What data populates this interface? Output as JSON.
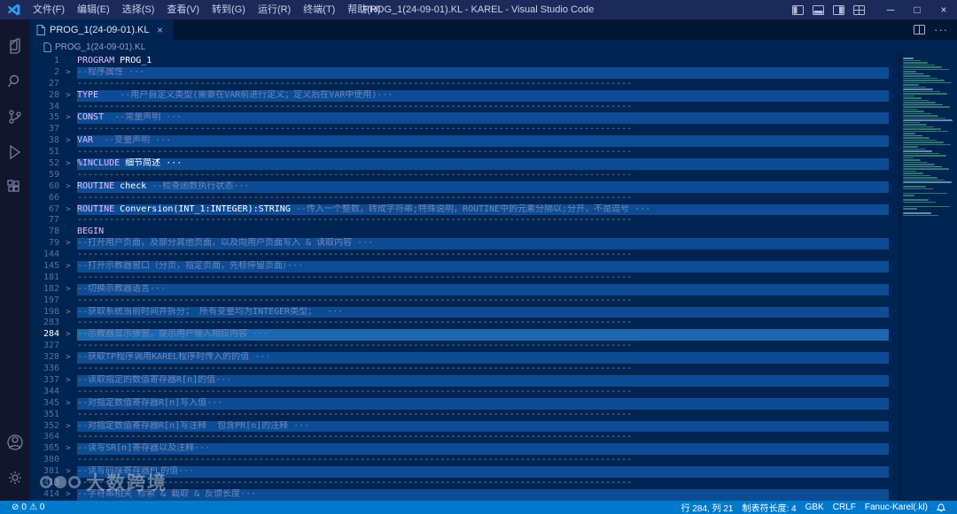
{
  "window": {
    "title": "PROG_1(24-09-01).KL - KAREL - Visual Studio Code",
    "menus": [
      "文件(F)",
      "编辑(E)",
      "选择(S)",
      "查看(V)",
      "转到(G)",
      "运行(R)",
      "终端(T)",
      "帮助(H)"
    ],
    "controls": {
      "minimize": "─",
      "maximize": "□",
      "close": "×"
    }
  },
  "tabs": [
    {
      "label": "PROG_1(24-09-01).KL",
      "close": "×",
      "active": true
    }
  ],
  "tabbar_actions": {
    "more": "···"
  },
  "breadcrumb": {
    "file": "PROG_1(24-09-01).KL"
  },
  "activity_bar": {
    "items": [
      "explorer",
      "search",
      "source-control",
      "run-debug",
      "extensions"
    ],
    "bottom": [
      "account",
      "settings"
    ]
  },
  "editor": {
    "dash_text": "--------------------------------------------------------------------------------------------------------",
    "fold_chevron": ">",
    "lines": [
      {
        "n": 1,
        "s": [
          {
            "t": "PROGRAM ",
            "c": "kw"
          },
          {
            "t": "PROG_1",
            "c": "id"
          }
        ]
      },
      {
        "n": 2,
        "f": true,
        "s": [
          {
            "t": "--程序属性 ···",
            "c": "cm"
          }
        ]
      },
      {
        "n": 27,
        "d": true
      },
      {
        "n": 28,
        "f": true,
        "s": [
          {
            "t": "TYPE",
            "c": "kw"
          },
          {
            "t": "    --用户自定义类型(需要在VAR前进行定义；定义后在VAR中使用)···",
            "c": "cm"
          }
        ]
      },
      {
        "n": 34,
        "d": true
      },
      {
        "n": 35,
        "f": true,
        "s": [
          {
            "t": "CONST",
            "c": "kw"
          },
          {
            "t": "  --常量声明 ···",
            "c": "cm"
          }
        ]
      },
      {
        "n": 37,
        "d": true
      },
      {
        "n": 38,
        "f": true,
        "s": [
          {
            "t": "VAR",
            "c": "kw"
          },
          {
            "t": "  --变量声明 ···",
            "c": "cm"
          }
        ]
      },
      {
        "n": 51,
        "d": true
      },
      {
        "n": 52,
        "f": true,
        "s": [
          {
            "t": "%INCLUDE ",
            "c": "kw"
          },
          {
            "t": "细节简述 ···",
            "c": "id"
          }
        ]
      },
      {
        "n": 59,
        "d": true
      },
      {
        "n": 60,
        "f": true,
        "s": [
          {
            "t": "ROUTINE",
            "c": "kw"
          },
          {
            "t": " check ",
            "c": "id"
          },
          {
            "t": "--检查函数执行状态···",
            "c": "cm"
          }
        ]
      },
      {
        "n": 66,
        "d": true
      },
      {
        "n": 67,
        "f": true,
        "s": [
          {
            "t": "ROUTINE",
            "c": "kw"
          },
          {
            "t": " Conversion(INT_1:INTEGER):STRING ",
            "c": "id"
          },
          {
            "t": "--传入一个整数，转成字符串;特殊说明，ROUTINE中的元素分隔以;分开，不是逗号 ···",
            "c": "cm"
          }
        ]
      },
      {
        "n": 77,
        "d": true
      },
      {
        "n": 78,
        "s": [
          {
            "t": "BEGIN",
            "c": "kw"
          }
        ]
      },
      {
        "n": 79,
        "f": true,
        "s": [
          {
            "t": "--打开用户页面，及部分其他页面，以及向用户页面写入 & 读取内容 ···",
            "c": "cm"
          }
        ]
      },
      {
        "n": 144,
        "d": true
      },
      {
        "n": 145,
        "f": true,
        "s": [
          {
            "t": "--打开示教器窗口（分页，指定页面，先标停留页面）···",
            "c": "cm"
          }
        ]
      },
      {
        "n": 181,
        "d": true
      },
      {
        "n": 182,
        "f": true,
        "s": [
          {
            "t": "--切换示教器语言···",
            "c": "cm"
          }
        ]
      },
      {
        "n": 197,
        "d": true
      },
      {
        "n": 198,
        "f": true,
        "s": [
          {
            "t": "--获取系统当前时间并拆分； 所有变量均为INTEGER类型；  ···",
            "c": "cm"
          }
        ]
      },
      {
        "n": 283,
        "d": true
      },
      {
        "n": 284,
        "f": true,
        "cur": true,
        "s": [
          {
            "t": "--示教器显示弹窗，提示用户输入相应内容 ···",
            "c": "cm"
          }
        ]
      },
      {
        "n": 327,
        "d": true
      },
      {
        "n": 328,
        "f": true,
        "s": [
          {
            "t": "--获取TP程序调用KAREL程序时传入的的值 ···",
            "c": "cm"
          }
        ]
      },
      {
        "n": 336,
        "d": true
      },
      {
        "n": 337,
        "f": true,
        "s": [
          {
            "t": "--读取指定的数值寄存器R[n]的值···",
            "c": "cm"
          }
        ]
      },
      {
        "n": 344,
        "d": true
      },
      {
        "n": 345,
        "f": true,
        "s": [
          {
            "t": "--对指定数值寄存器R[n]写入值···",
            "c": "cm"
          }
        ]
      },
      {
        "n": 351,
        "d": true
      },
      {
        "n": 352,
        "f": true,
        "s": [
          {
            "t": "--对指定数值寄存器R[n]写注释  包含PR[n]的注释 ···",
            "c": "cm"
          }
        ]
      },
      {
        "n": 364,
        "d": true
      },
      {
        "n": 365,
        "f": true,
        "s": [
          {
            "t": "--读写SR[n]寄存器以及注释···",
            "c": "cm"
          }
        ]
      },
      {
        "n": 380,
        "d": true
      },
      {
        "n": 381,
        "f": true,
        "s": [
          {
            "t": "--读写码垛寄存器PL的值···",
            "c": "cm"
          }
        ]
      },
      {
        "n": 413,
        "d": true
      },
      {
        "n": 414,
        "f": true,
        "s": [
          {
            "t": "--字符串相关 检索 & 截取 & 反馈长度···",
            "c": "cm"
          }
        ]
      }
    ]
  },
  "status_bar": {
    "errors": "0",
    "warnings": "0",
    "cursor": "行 284, 列 21",
    "indent": "制表符长度: 4",
    "encoding": "GBK",
    "eol": "CRLF",
    "language": "Fanuc-Karel(.kl)"
  },
  "watermark": {
    "text": "大数跨境"
  },
  "colors": {
    "editor_bg": "#002451",
    "fold_band": "#0d4c94",
    "current_band": "#1c67b0",
    "status_bg": "#007acc",
    "comment": "#7285b7",
    "keyword": "#ebbbff"
  }
}
